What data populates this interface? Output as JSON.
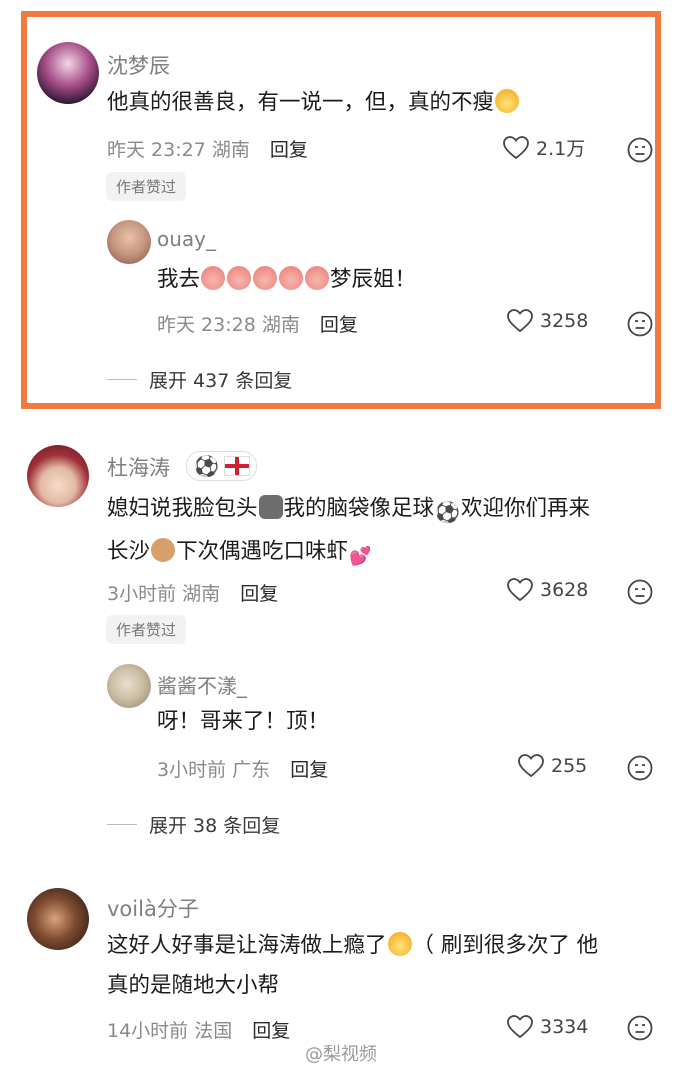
{
  "comments": [
    {
      "name": "沈梦辰",
      "text": "他真的很善良，有一说一，但，真的不瘦",
      "time": "昨天 23:27",
      "location": "湖南",
      "reply_label": "回复",
      "likes": "2.1万",
      "badge": "作者赞过",
      "replies": [
        {
          "name": "ouay_",
          "text_prefix": "我去",
          "text_suffix": "梦辰姐！",
          "time": "昨天 23:28",
          "location": "湖南",
          "reply_label": "回复",
          "likes": "3258"
        }
      ],
      "expand": "展开 437 条回复"
    },
    {
      "name": "杜海涛",
      "text_line1_a": "媳妇说我脸包头",
      "text_line1_b": "我的脑袋像足球",
      "text_line1_c": "欢迎你们再来",
      "text_line2_a": "长沙",
      "text_line2_b": "下次偶遇吃口味虾",
      "time": "3小时前",
      "location": "湖南",
      "reply_label": "回复",
      "likes": "3628",
      "badge": "作者赞过",
      "replies": [
        {
          "name": "酱酱不漾_",
          "text": "呀！哥来了！顶！",
          "time": "3小时前",
          "location": "广东",
          "reply_label": "回复",
          "likes": "255"
        }
      ],
      "expand": "展开 38 条回复"
    },
    {
      "name": "voilà分子",
      "text_line1_a": "这好人好事是让海涛做上瘾了",
      "text_line1_b": "（ 刷到很多次了 他",
      "text_line2": "真的是随地大小帮",
      "time": "14小时前",
      "location": "法国",
      "reply_label": "回复",
      "likes": "3334"
    }
  ],
  "watermark": "@梨视频",
  "colors": {
    "highlight": "#f07a3f",
    "meta": "#8a8a8a"
  }
}
